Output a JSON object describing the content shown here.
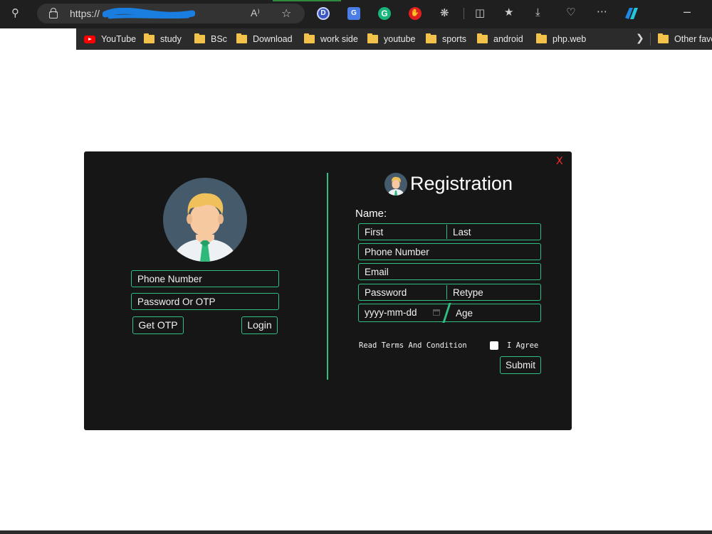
{
  "browser": {
    "url_prefix": "https://",
    "read_aloud_glyph": "A⁾",
    "bookmarks": [
      {
        "label": "YouTube",
        "type": "youtube"
      },
      {
        "label": "study",
        "type": "folder"
      },
      {
        "label": "BSc",
        "type": "folder"
      },
      {
        "label": "Download",
        "type": "folder"
      },
      {
        "label": "work side",
        "type": "folder"
      },
      {
        "label": "youtube",
        "type": "folder"
      },
      {
        "label": "sports",
        "type": "folder"
      },
      {
        "label": "android",
        "type": "folder"
      },
      {
        "label": "php.web",
        "type": "folder"
      },
      {
        "label": "Other favo",
        "type": "folder"
      }
    ],
    "extension_letters": {
      "d": "D",
      "t": "G",
      "g": "G",
      "h": "✋"
    }
  },
  "login": {
    "phone_placeholder": "Phone Number",
    "password_placeholder": "Password Or OTP",
    "get_otp_label": "Get OTP",
    "login_label": "Login"
  },
  "registration": {
    "close_label": "X",
    "title": "Registration",
    "name_label": "Name:",
    "first_placeholder": "First",
    "last_placeholder": "Last",
    "phone_placeholder": "Phone Number",
    "email_placeholder": "Email",
    "password_placeholder": "Password",
    "retype_placeholder": "Retype",
    "date_placeholder": "yyyy-mm-dd",
    "age_placeholder": "Age",
    "terms_label": "Read Terms And Condition",
    "agree_label": "I Agree",
    "submit_label": "Submit"
  },
  "colors": {
    "accent": "#2fbf83",
    "modal_bg": "#161616",
    "close": "#ff2a2a"
  }
}
